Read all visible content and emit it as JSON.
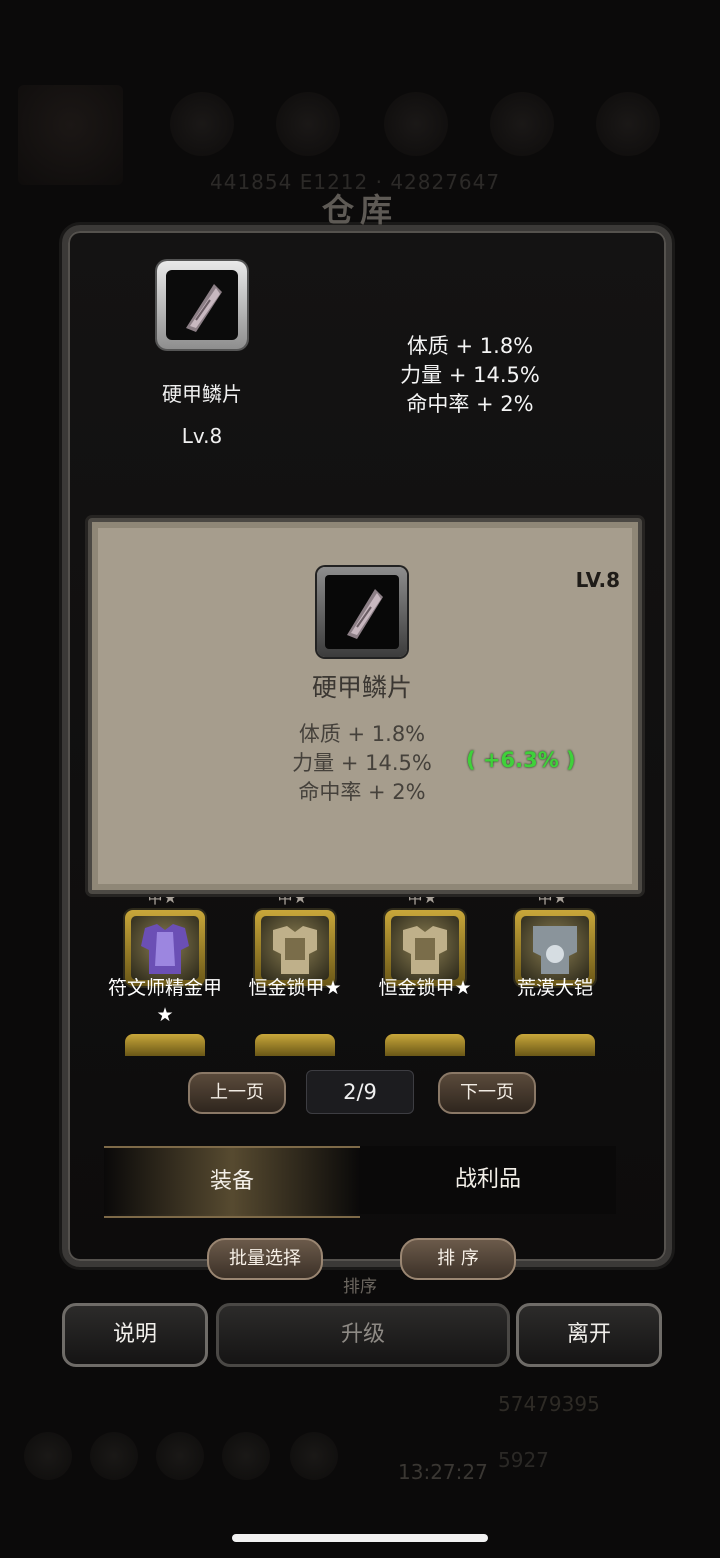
{
  "background": {
    "numbers": "441854  E1212  ·  42827647",
    "gold": "57479395",
    "gems": "5927",
    "clock": "13:27:27"
  },
  "window": {
    "title": "仓库"
  },
  "selected_item": {
    "name": "硬甲鳞片",
    "level": "Lv.8",
    "stats": [
      "体质 + 1.8%",
      "力量 + 14.5%",
      "命中率 + 2%"
    ]
  },
  "tooltip": {
    "level": "LV.8",
    "name": "硬甲鳞片",
    "stats": [
      "体质 + 1.8%",
      "力量 + 14.5%",
      "命中率 + 2%"
    ],
    "diff": "( +6.3% )"
  },
  "inventory": {
    "star_tabs": [
      "甲★",
      "甲★",
      "甲★",
      "甲★"
    ],
    "items": [
      {
        "name": "符文师精金甲★",
        "icon": "purple-armor-icon"
      },
      {
        "name": "恒金锁甲★",
        "icon": "gold-chainmail-icon"
      },
      {
        "name": "恒金锁甲★",
        "icon": "gold-chainmail-icon"
      },
      {
        "name": "荒漠大铠",
        "icon": "silver-plate-armor-icon"
      }
    ]
  },
  "pager": {
    "prev": "上一页",
    "page": "2/9",
    "next": "下一页"
  },
  "tabs": {
    "equipment": "装备",
    "loot": "战利品"
  },
  "actions": {
    "batch_select": "批量选择",
    "sort": "排 序",
    "ghost_sort": "排序"
  },
  "bottom": {
    "help": "说明",
    "upgrade": "升级",
    "leave": "离开"
  },
  "colors": {
    "diff_green": "#3fd13a",
    "card_bg": "#a69d8d",
    "gold_frame": "#c9a73a"
  }
}
